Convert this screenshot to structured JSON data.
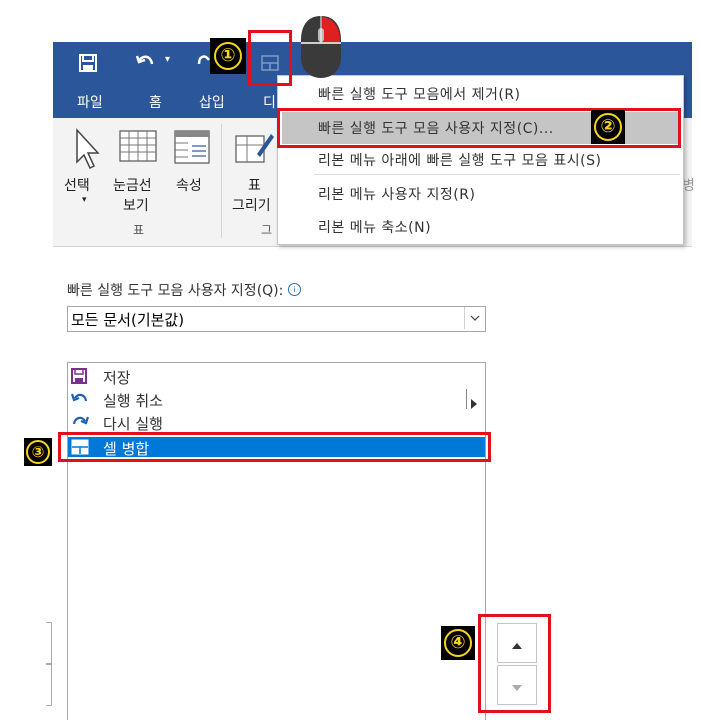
{
  "ribbon": {
    "tabs": [
      "파일",
      "홈",
      "삽입",
      "디"
    ],
    "groups": {
      "select_label": "선택",
      "gridlines_label_1": "눈금선",
      "gridlines_label_2": "보기",
      "properties_label": "속성",
      "table_group_label": "표",
      "draw_label_1": "표",
      "draw_label_2": "그리기",
      "draw_group_label": "그"
    }
  },
  "menu": {
    "items": [
      "빠른 실행 도구 모음에서 제거(R)",
      "빠른 실행 도구 모음 사용자 지정(C)...",
      "리본 메뉴 아래에 빠른 실행 도구 모음 표시(S)",
      "리본 메뉴 사용자 지정(R)",
      "리본 메뉴 축소(N)"
    ]
  },
  "customize": {
    "label": "빠른 실행 도구 모음 사용자 지정(Q):",
    "info_icon": "info-icon",
    "combo_value": "모든 문서(기본값)",
    "list": [
      {
        "label": "저장",
        "icon": "save-icon"
      },
      {
        "label": "실행 취소",
        "icon": "undo-icon"
      },
      {
        "label": "다시 실행",
        "icon": "redo-icon"
      },
      {
        "label": "셀 병합",
        "icon": "merge-cells-icon",
        "selected": true
      }
    ]
  },
  "badges": [
    "①",
    "②",
    "③",
    "④"
  ],
  "colors": {
    "accent": "#2b579a",
    "highlight": "#e3101b",
    "selection": "#0078d7",
    "badge_text": "#f7d51d"
  }
}
